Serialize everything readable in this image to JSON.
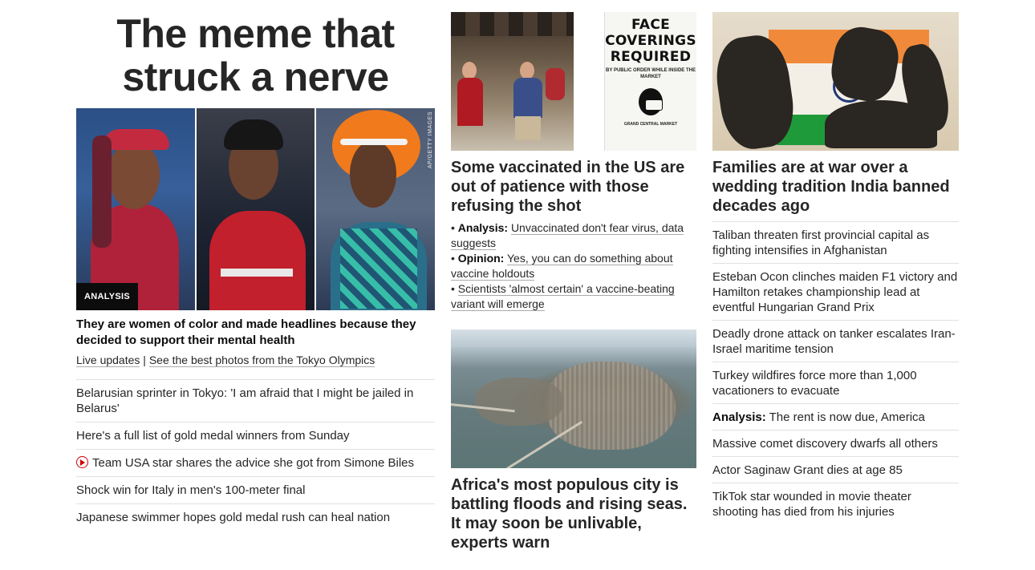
{
  "left": {
    "big_headline": "The meme that struck a nerve",
    "hero_credit": "AP/GETTY IMAGES",
    "hero_tag": "ANALYSIS",
    "hero_title": "They are women of color and made headlines because they decided to support their mental health",
    "hero_link_1": "Live updates",
    "hero_link_sep": " | ",
    "hero_link_2": "See the best photos from the Tokyo Olympics",
    "items": [
      "Belarusian sprinter in Tokyo: 'I am afraid that I might be jailed in Belarus'",
      "Here's a full list of gold medal winners from Sunday",
      "Team USA star shares the advice she got from Simone Biles",
      "Shock win for Italy in men's 100-meter final",
      "Japanese swimmer hopes gold medal rush can heal nation"
    ]
  },
  "middle": {
    "sign_text": "FACE COVERINGS REQUIRED",
    "sign_small": "BY PUBLIC ORDER WHILE INSIDE THE MARKET",
    "sign_foot": "GRAND CENTRAL MARKET",
    "story1_title": "Some vaccinated in the US are out of patience with those refusing the shot",
    "bullets": [
      {
        "prefix": "Analysis:",
        "text": "Unvaccinated don't fear virus, data suggests"
      },
      {
        "prefix": "Opinion:",
        "text": "Yes, you can do something about vaccine holdouts"
      },
      {
        "prefix": "",
        "text": "Scientists 'almost certain' a vaccine-beating variant will emerge"
      }
    ],
    "story2_title": "Africa's most populous city is battling floods and rising seas. It may soon be unlivable, experts warn"
  },
  "right": {
    "story_title": "Families are at war over a wedding tradition India banned decades ago",
    "items": [
      {
        "prefix": "",
        "text": "Taliban threaten first provincial capital as fighting intensifies in Afghanistan"
      },
      {
        "prefix": "",
        "text": "Esteban Ocon clinches maiden F1 victory and Hamilton retakes championship lead at eventful Hungarian Grand Prix"
      },
      {
        "prefix": "",
        "text": "Deadly drone attack on tanker escalates Iran-Israel maritime tension"
      },
      {
        "prefix": "",
        "text": "Turkey wildfires force more than 1,000 vacationers to evacuate"
      },
      {
        "prefix": "Analysis:",
        "text": "The rent is now due, America"
      },
      {
        "prefix": "",
        "text": "Massive comet discovery dwarfs all others"
      },
      {
        "prefix": "",
        "text": "Actor Saginaw Grant dies at age 85"
      },
      {
        "prefix": "",
        "text": "TikTok star wounded in movie theater shooting has died from his injuries"
      }
    ]
  },
  "colors": {
    "text": "#262626",
    "rule": "#e1e1e1",
    "video_icon": "#cc0000"
  }
}
